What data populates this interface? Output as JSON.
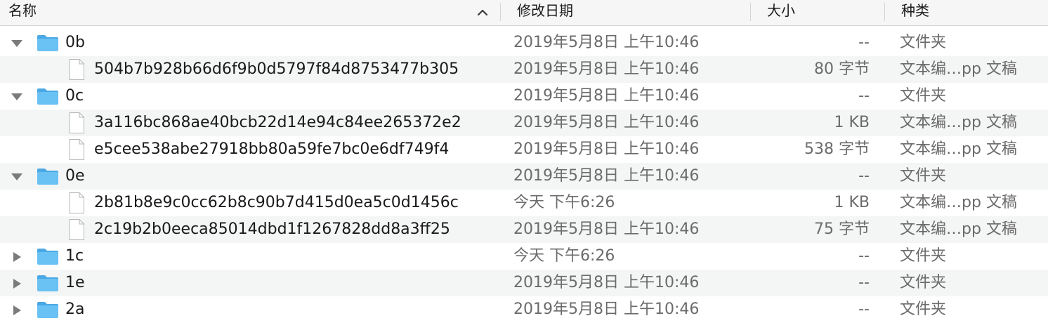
{
  "columns": {
    "name": "名称",
    "date": "修改日期",
    "size": "大小",
    "kind": "种类"
  },
  "rows": [
    {
      "type": "folder",
      "expanded": true,
      "name": "0b",
      "date": "2019年5月8日 上午10:46",
      "size": "--",
      "kind": "文件夹"
    },
    {
      "type": "file",
      "name": "504b7b928b66d6f9b0d5797f84d8753477b305",
      "date": "2019年5月8日 上午10:46",
      "size": "80 字节",
      "kind": "文本编…pp 文稿"
    },
    {
      "type": "folder",
      "expanded": true,
      "name": "0c",
      "date": "2019年5月8日 上午10:46",
      "size": "--",
      "kind": "文件夹"
    },
    {
      "type": "file",
      "name": "3a116bc868ae40bcb22d14e94c84ee265372e2",
      "date": "2019年5月8日 上午10:46",
      "size": "1 KB",
      "kind": "文本编…pp 文稿"
    },
    {
      "type": "file",
      "name": "e5cee538abe27918bb80a59fe7bc0e6df749f4",
      "date": "2019年5月8日 上午10:46",
      "size": "538 字节",
      "kind": "文本编…pp 文稿"
    },
    {
      "type": "folder",
      "expanded": true,
      "name": "0e",
      "date": "2019年5月8日 上午10:46",
      "size": "--",
      "kind": "文件夹"
    },
    {
      "type": "file",
      "name": "2b81b8e9c0cc62b8c90b7d415d0ea5c0d1456c",
      "date": "今天 下午6:26",
      "size": "1 KB",
      "kind": "文本编…pp 文稿"
    },
    {
      "type": "file",
      "name": "2c19b2b0eeca85014dbd1f1267828dd8a3ff25",
      "date": "2019年5月8日 上午10:46",
      "size": "75 字节",
      "kind": "文本编…pp 文稿"
    },
    {
      "type": "folder",
      "expanded": false,
      "name": "1c",
      "date": "今天 下午6:26",
      "size": "--",
      "kind": "文件夹"
    },
    {
      "type": "folder",
      "expanded": false,
      "name": "1e",
      "date": "2019年5月8日 上午10:46",
      "size": "--",
      "kind": "文件夹"
    },
    {
      "type": "folder",
      "expanded": false,
      "name": "2a",
      "date": "2019年5月8日 上午10:46",
      "size": "--",
      "kind": "文件夹"
    }
  ],
  "colors": {
    "folder_icon": "#6ac1f4",
    "folder_icon_dark": "#4aa8e4",
    "disclosure": "#7b7b7b",
    "row_alt": "#f4f5f5",
    "secondary_text": "#6b6b6b"
  },
  "icons": {
    "sort": "chevron-up-icon",
    "folder": "folder-icon",
    "file": "document-icon",
    "expanded": "triangle-down-icon",
    "collapsed": "triangle-right-icon"
  }
}
